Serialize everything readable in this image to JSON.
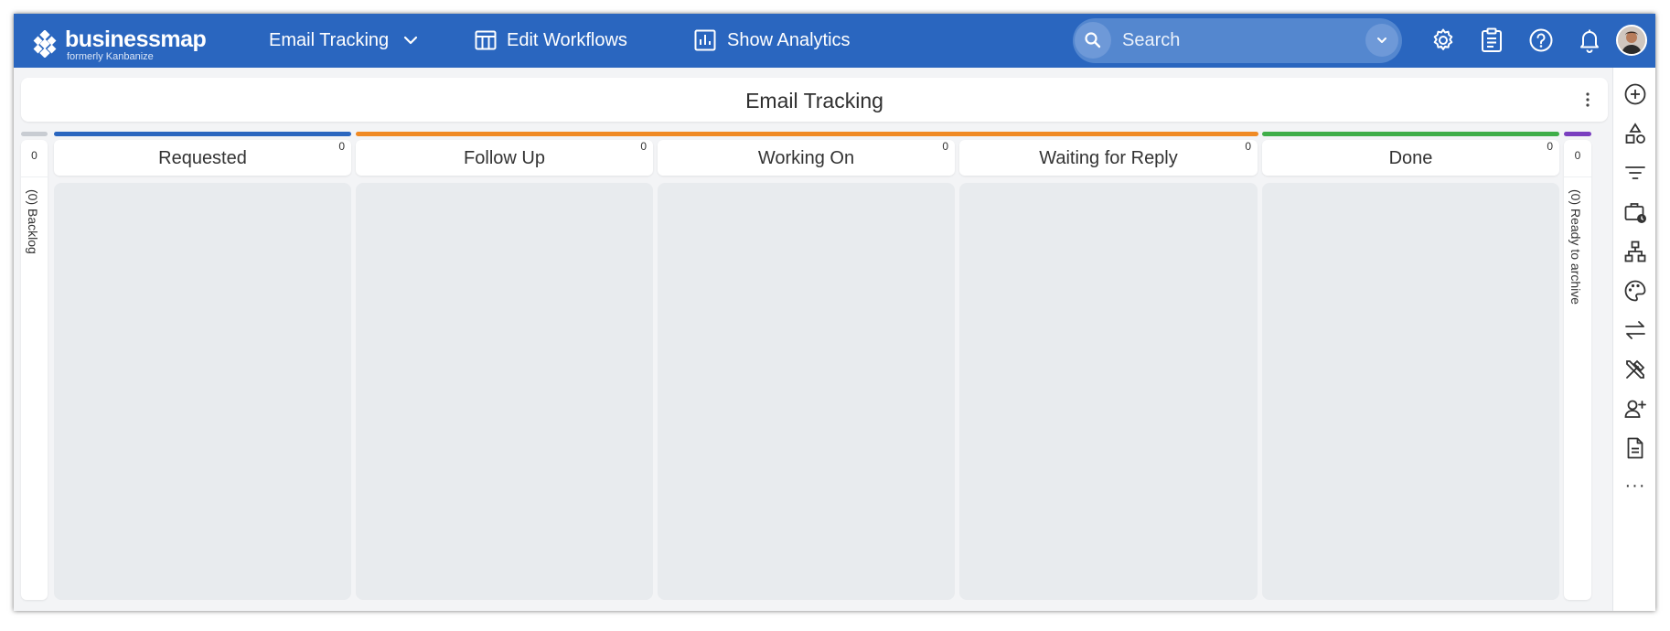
{
  "app": {
    "brand_name": "businessmap",
    "brand_sub": "formerly Kanbanize",
    "colors": {
      "topbar": "#2a66bf",
      "requested": "#2a66bf",
      "follow_up": "#f08a24",
      "working_on": "#f08a24",
      "done": "#3fae49",
      "archive": "#7a3fbf",
      "backlog": "#c8ccd2"
    }
  },
  "topbar": {
    "board_select": "Email Tracking",
    "edit_workflows": "Edit Workflows",
    "show_analytics": "Show Analytics",
    "search_placeholder": "Search",
    "icons": [
      "search-icon",
      "chevron-down-icon",
      "gear-icon",
      "clipboard-icon",
      "help-icon",
      "bell-icon",
      "avatar"
    ]
  },
  "board": {
    "title": "Email Tracking",
    "backlog": {
      "count": "0",
      "label": "(0) Backlog"
    },
    "archive": {
      "count": "0",
      "label": "(0) Ready to archive"
    },
    "columns": [
      {
        "name": "Requested",
        "count": "0",
        "color": "#2a66bf"
      },
      {
        "name": "Follow Up",
        "count": "0",
        "color": "#f08a24"
      },
      {
        "name": "Working On",
        "count": "0",
        "color": "#f08a24"
      },
      {
        "name": "Waiting for Reply",
        "count": "0",
        "color": "#f08a24"
      },
      {
        "name": "Done",
        "count": "0",
        "color": "#3fae49"
      }
    ]
  },
  "rail": {
    "icons": [
      "add-icon",
      "shapes-icon",
      "filter-icon",
      "briefcase-clock-icon",
      "hierarchy-icon",
      "palette-icon",
      "swap-arrows-icon",
      "tools-icon",
      "add-user-icon",
      "document-icon",
      "more-icon"
    ],
    "more_label": "···"
  }
}
